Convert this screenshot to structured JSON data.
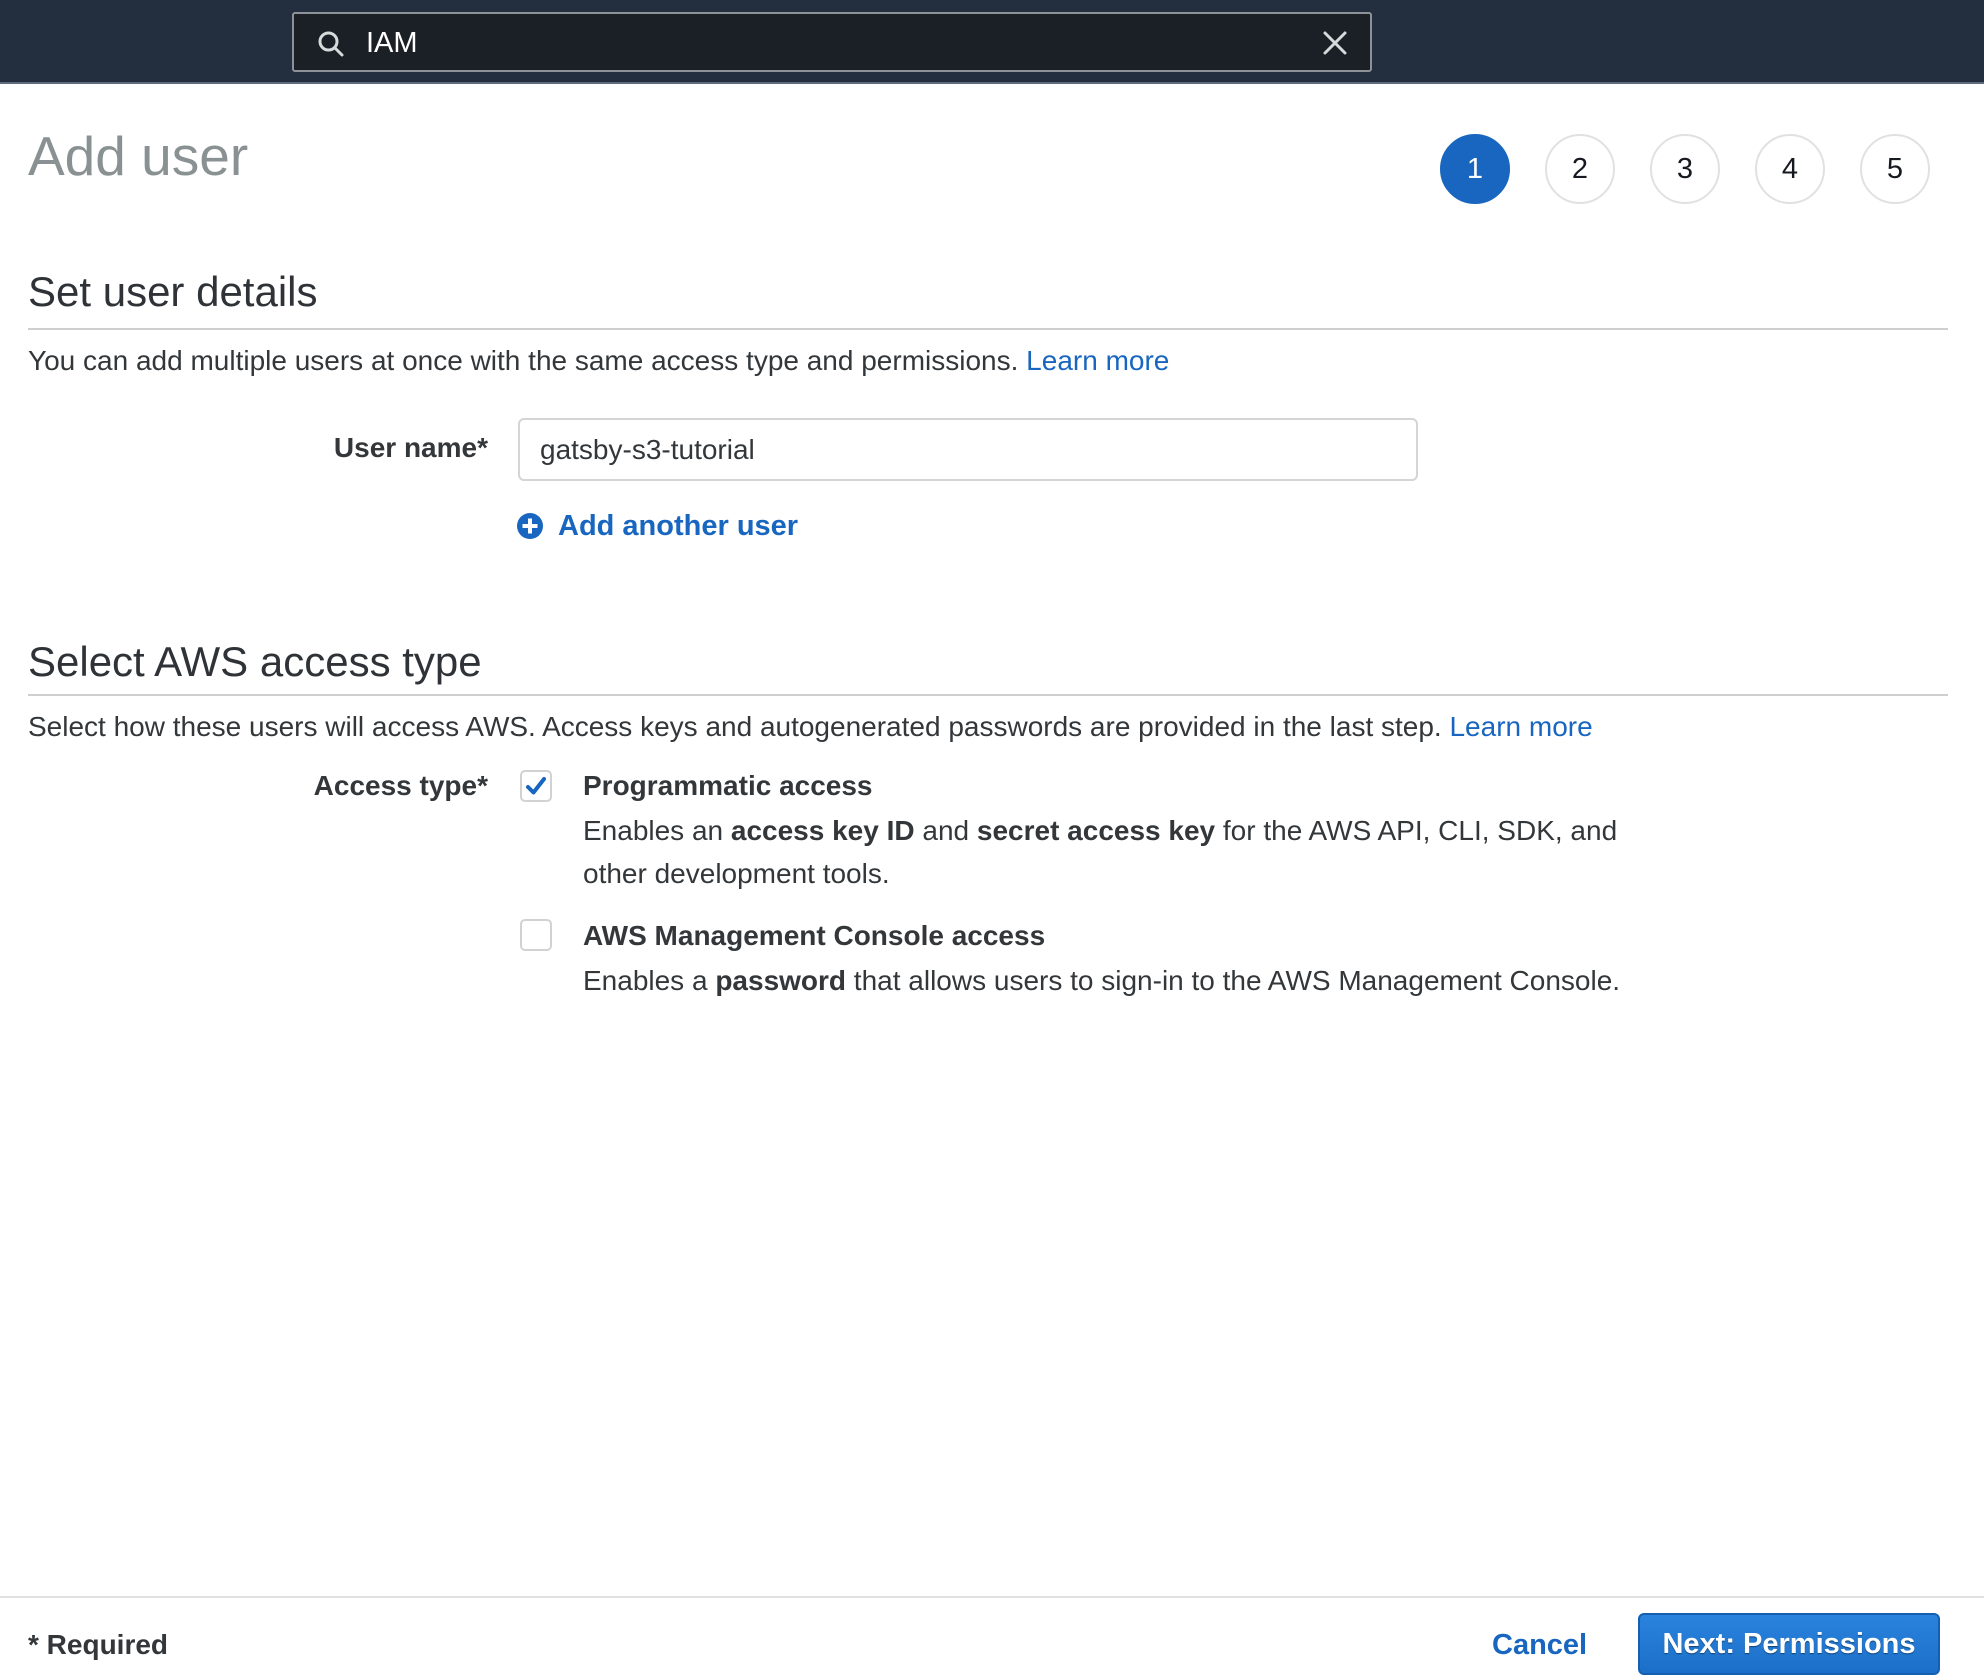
{
  "topbar": {
    "search_value": "IAM",
    "search_icon": "search-icon",
    "clear_icon": "close-icon"
  },
  "page": {
    "title": "Add user"
  },
  "steps": {
    "current": 1,
    "items": [
      "1",
      "2",
      "3",
      "4",
      "5"
    ]
  },
  "user_details": {
    "title": "Set user details",
    "description": "You can add multiple users at once with the same access type and permissions.",
    "learn_more": "Learn more",
    "user_name_label": "User name*",
    "user_name_value": "gatsby-s3-tutorial",
    "add_another_label": "Add another user",
    "add_icon": "plus-circle-icon"
  },
  "access_type": {
    "title": "Select AWS access type",
    "description": "Select how these users will access AWS. Access keys and autogenerated passwords are provided in the last step.",
    "learn_more": "Learn more",
    "label": "Access type*",
    "options": [
      {
        "title": "Programmatic access",
        "checked": true,
        "desc_parts": [
          "Enables an ",
          "access key ID",
          " and ",
          "secret access key",
          " for the AWS API, CLI, SDK, and other development tools."
        ]
      },
      {
        "title": "AWS Management Console access",
        "checked": false,
        "desc_parts": [
          "Enables a ",
          "password",
          " that allows users to sign-in to the AWS Management Console."
        ]
      }
    ]
  },
  "footer": {
    "required_note": "* Required",
    "cancel_label": "Cancel",
    "next_label": "Next: Permissions"
  },
  "colors": {
    "accent": "#1866bf",
    "topbar": "#232f3e",
    "title_gray": "#8a9193"
  }
}
